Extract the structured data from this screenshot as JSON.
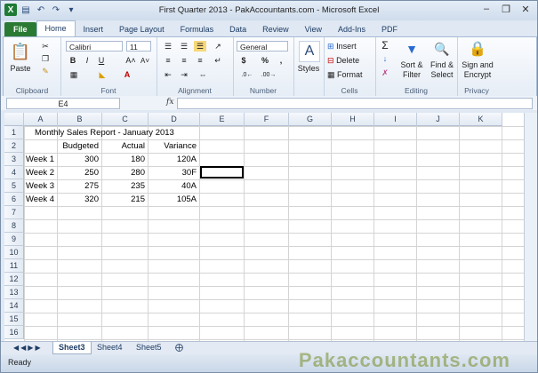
{
  "window": {
    "title": "First Quarter 2013 - PakAccountants.com - Microsoft Excel"
  },
  "tabs": [
    "File",
    "Home",
    "Insert",
    "Page Layout",
    "Formulas",
    "Data",
    "Review",
    "View",
    "Add-Ins",
    "PDF"
  ],
  "ribbon": {
    "clipboard": {
      "label": "Clipboard",
      "paste": "Paste"
    },
    "font": {
      "label": "Font",
      "font_name": "Calibri",
      "font_size": "11"
    },
    "alignment": {
      "label": "Alignment"
    },
    "number": {
      "label": "Number",
      "format": "General",
      "currency": "$",
      "percent": "%",
      "comma": ","
    },
    "styles": {
      "label": "Styles"
    },
    "cells": {
      "label": "Cells",
      "insert": "Insert",
      "delete": "Delete",
      "format": "Format"
    },
    "editing": {
      "label": "Editing",
      "sort_filter": "Sort &",
      "sort_filter2": "Filter",
      "find_select": "Find &",
      "find_select2": "Select"
    },
    "privacy": {
      "label": "Privacy",
      "sign": "Sign and",
      "sign2": "Encrypt"
    }
  },
  "formula_bar": {
    "name_box": "E4",
    "fx": "fx",
    "formula": ""
  },
  "columns": [
    "A",
    "B",
    "C",
    "D",
    "E",
    "F",
    "G",
    "H",
    "I",
    "J",
    "K"
  ],
  "rows": [
    "1",
    "2",
    "3",
    "4",
    "5",
    "6",
    "7",
    "8",
    "9",
    "10",
    "11",
    "12",
    "13",
    "14",
    "15",
    "16"
  ],
  "cells": {
    "A1": "Monthly Sales Report - January 2013",
    "B2": "Budgeted",
    "C2": "Actual",
    "D2": "Variance",
    "A3": "Week 1",
    "B3": "300",
    "C3": "180",
    "D3": "120A",
    "A4": "Week 2",
    "B4": "250",
    "C4": "280",
    "D4": "30F",
    "A5": "Week 3",
    "B5": "275",
    "C5": "235",
    "D5": "40A",
    "A6": "Week 4",
    "B6": "320",
    "C6": "215",
    "D6": "105A"
  },
  "sheet_tabs": [
    "Sheet3",
    "Sheet4",
    "Sheet5"
  ],
  "active_sheet": "Sheet3",
  "status": "Ready",
  "watermark": "Pakaccountants.com",
  "colors": {
    "file_tab": "#2b7a33",
    "accent": "#1e3c64"
  }
}
